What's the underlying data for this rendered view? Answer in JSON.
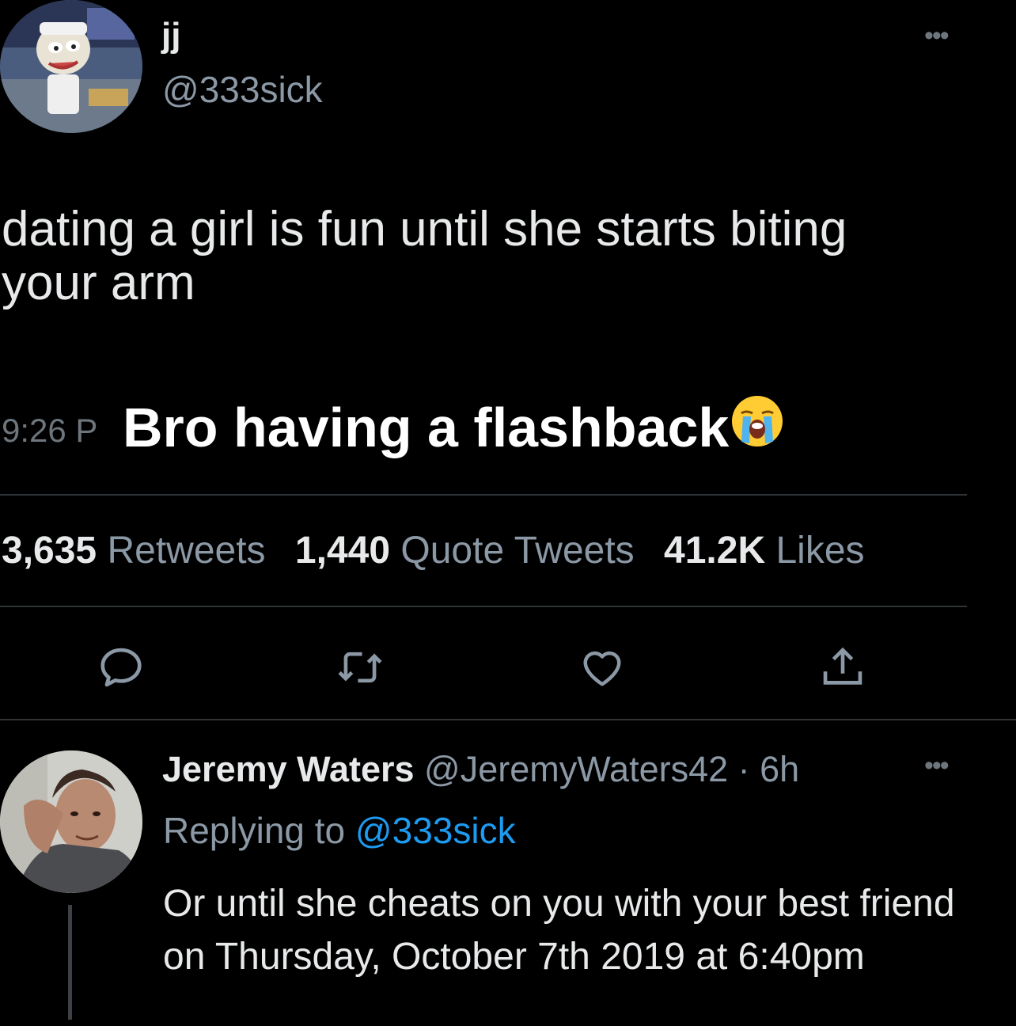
{
  "tweet": {
    "display_name": "jj",
    "handle": "@333sick",
    "text": "dating a girl is fun until she starts biting your arm",
    "timestamp": "9:26 P",
    "more_icon": "more-icon",
    "stats": {
      "retweets_count": "3,635",
      "retweets_label": "Retweets",
      "quotes_count": "1,440",
      "quotes_label": "Quote Tweets",
      "likes_count": "41.2K",
      "likes_label": "Likes"
    },
    "actions": [
      "reply-icon",
      "retweet-icon",
      "like-icon",
      "share-icon"
    ]
  },
  "overlay": {
    "caption": "Bro having a flashback",
    "emoji": "loudly-crying-face"
  },
  "reply": {
    "display_name": "Jeremy Waters",
    "meta": "@JeremyWaters42 · 6h",
    "replying_label": "Replying to",
    "replying_handle": "@333sick",
    "text": "Or until she cheats on you with your best friend on Thursday, October 7th 2019 at 6:40pm"
  },
  "colors": {
    "background": "#000000",
    "primary_text": "#e7e9ea",
    "secondary_text": "#8b98a5",
    "accent": "#1d9bf0",
    "divider": "#2f3336"
  }
}
